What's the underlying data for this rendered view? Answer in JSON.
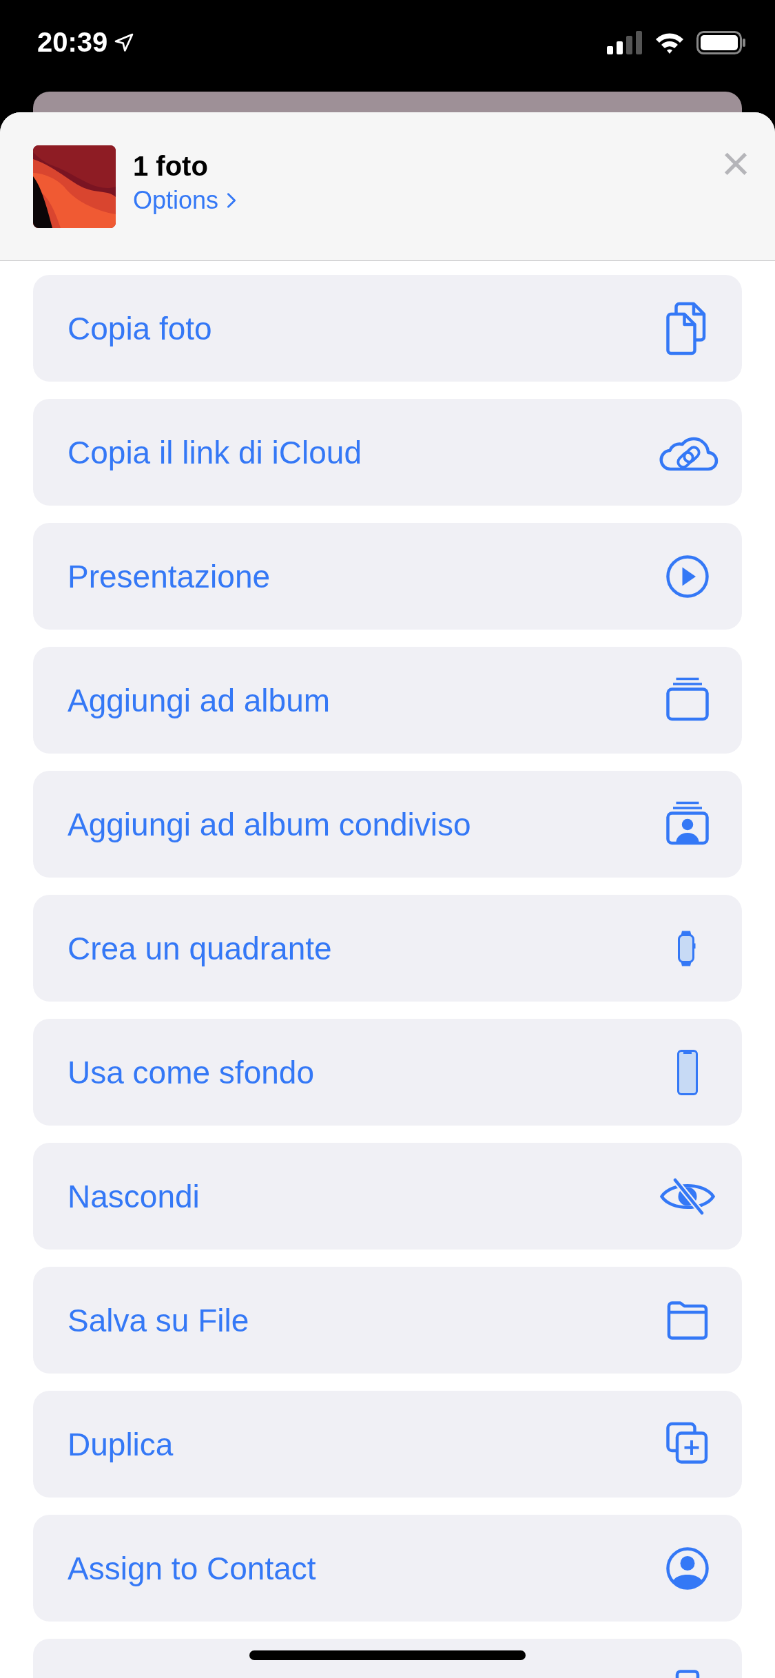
{
  "status_bar": {
    "time": "20:39"
  },
  "header": {
    "title": "1 foto",
    "options": "Options",
    "close": "×"
  },
  "actions": [
    {
      "label": "Copia foto"
    },
    {
      "label": "Copia il link di iCloud"
    },
    {
      "label": "Presentazione"
    },
    {
      "label": "Aggiungi ad album"
    },
    {
      "label": "Aggiungi ad album condiviso"
    },
    {
      "label": "Crea un quadrante"
    },
    {
      "label": "Usa come sfondo"
    },
    {
      "label": "Nascondi"
    },
    {
      "label": "Salva su File"
    },
    {
      "label": "Duplica"
    },
    {
      "label": "Assign to Contact"
    }
  ]
}
